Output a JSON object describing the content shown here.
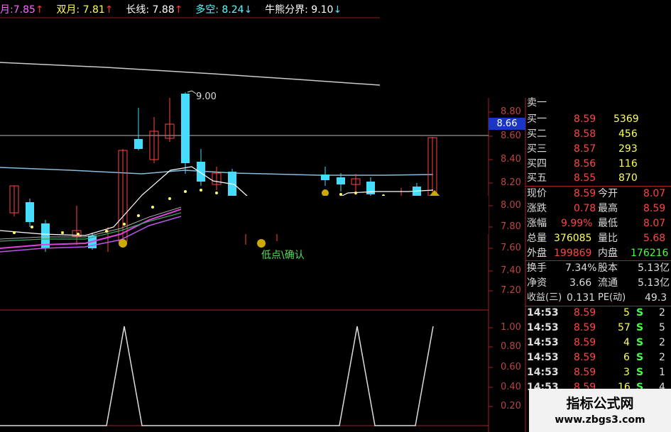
{
  "header": {
    "items": [
      {
        "label": "月:",
        "value": "7.85",
        "arrow": "↑",
        "color": "#ff66ff"
      },
      {
        "label": "双月:",
        "value": "7.81",
        "arrow": "↑",
        "color": "#ffff55"
      },
      {
        "label": "长线:",
        "value": "7.88",
        "arrow": "↑",
        "color": "#ffffff"
      },
      {
        "label": "多空:",
        "value": "8.24",
        "arrow": "↓",
        "color": "#55ffff"
      },
      {
        "label": "牛熊分界:",
        "value": "9.10",
        "arrow": "↓",
        "color": "#ffffff"
      }
    ]
  },
  "chart": {
    "high_label": "9.00",
    "signal_label": "低点\\确认",
    "current_price": "8.66",
    "price_axis": [
      "8.80",
      "8.60",
      "8.40",
      "8.20",
      "8.00",
      "7.80",
      "7.60",
      "7.40",
      "7.20"
    ],
    "indicator_axis": [
      "1.00",
      "0.80",
      "0.60",
      "0.40",
      "0.20"
    ]
  },
  "quote": {
    "sell1": "卖一",
    "bids": [
      {
        "label": "买一",
        "price": "8.59",
        "vol": "5369"
      },
      {
        "label": "买二",
        "price": "8.58",
        "vol": "456"
      },
      {
        "label": "买三",
        "price": "8.57",
        "vol": "293"
      },
      {
        "label": "买四",
        "price": "8.56",
        "vol": "116"
      },
      {
        "label": "买五",
        "price": "8.55",
        "vol": "870"
      }
    ],
    "stats": [
      {
        "l1": "现价",
        "v1": "8.59",
        "l2": "今开",
        "v2": "8.07",
        "c1": "#ff4444",
        "c2": "#ff4444"
      },
      {
        "l1": "涨跌",
        "v1": "0.78",
        "l2": "最高",
        "v2": "8.59",
        "c1": "#ff4444",
        "c2": "#ff4444"
      },
      {
        "l1": "涨幅",
        "v1": "9.99%",
        "l2": "最低",
        "v2": "8.07",
        "c1": "#ff4444",
        "c2": "#ff4444"
      },
      {
        "l1": "总量",
        "v1": "376085",
        "l2": "量比",
        "v2": "5.68",
        "c1": "#ffff55",
        "c2": "#ff4444"
      },
      {
        "l1": "外盘",
        "v1": "199869",
        "l2": "内盘",
        "v2": "176216",
        "c1": "#ff4444",
        "c2": "#44ff44"
      }
    ],
    "fundamentals": [
      {
        "l1": "换手",
        "v1": "7.34%",
        "l2": "股本",
        "v2": "5.13亿"
      },
      {
        "l1": "净资",
        "v1": "3.66",
        "l2": "流通",
        "v2": "5.13亿"
      },
      {
        "l1": "收益(三)",
        "v1": "0.131",
        "l2": "PE(动)",
        "v2": "49.3"
      }
    ],
    "ticks": [
      {
        "time": "14:53",
        "price": "8.59",
        "vol": "5",
        "side": "S",
        "n": "2"
      },
      {
        "time": "14:53",
        "price": "8.59",
        "vol": "57",
        "side": "S",
        "n": "5"
      },
      {
        "time": "14:53",
        "price": "8.59",
        "vol": "4",
        "side": "S",
        "n": "2"
      },
      {
        "time": "14:53",
        "price": "8.59",
        "vol": "6",
        "side": "S",
        "n": "2"
      },
      {
        "time": "14:53",
        "price": "8.59",
        "vol": "3",
        "side": "S",
        "n": "1"
      },
      {
        "time": "14:53",
        "price": "8.59",
        "vol": "16",
        "side": "S",
        "n": "4"
      }
    ]
  },
  "watermark": {
    "title": "指标公式网",
    "url": "www.zbgs3.com"
  }
}
